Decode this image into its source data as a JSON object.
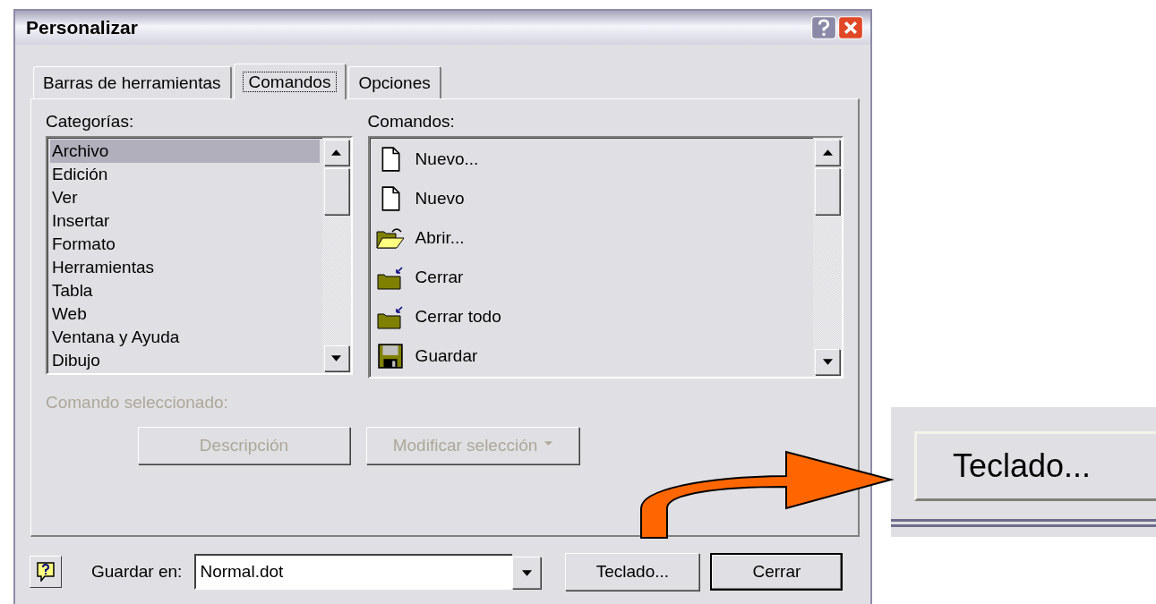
{
  "window": {
    "title": "Personalizar"
  },
  "tabs": [
    {
      "label": "Barras de herramientas",
      "selected": false
    },
    {
      "label": "Comandos",
      "selected": true
    },
    {
      "label": "Opciones",
      "selected": false
    }
  ],
  "categories": {
    "label": "Categorías:",
    "items": [
      {
        "label": "Archivo",
        "selected": true
      },
      {
        "label": "Edición",
        "selected": false
      },
      {
        "label": "Ver",
        "selected": false
      },
      {
        "label": "Insertar",
        "selected": false
      },
      {
        "label": "Formato",
        "selected": false
      },
      {
        "label": "Herramientas",
        "selected": false
      },
      {
        "label": "Tabla",
        "selected": false
      },
      {
        "label": "Web",
        "selected": false
      },
      {
        "label": "Ventana y Ayuda",
        "selected": false
      },
      {
        "label": "Dibujo",
        "selected": false
      }
    ]
  },
  "commands": {
    "label": "Comandos:",
    "items": [
      {
        "label": "Nuevo...",
        "kind": "new"
      },
      {
        "label": "Nuevo",
        "kind": "new"
      },
      {
        "label": "Abrir...",
        "kind": "open"
      },
      {
        "label": "Cerrar",
        "kind": "close"
      },
      {
        "label": "Cerrar todo",
        "kind": "close"
      },
      {
        "label": "Guardar",
        "kind": "save"
      }
    ]
  },
  "selected_command": {
    "label": "Comando seleccionado:",
    "disabled": true
  },
  "command_buttons": [
    {
      "label": "Descripción",
      "disabled": true,
      "dropdown": false
    },
    {
      "label": "Modificar selección",
      "disabled": true,
      "dropdown": true
    }
  ],
  "save_in": {
    "label": "Guardar en:",
    "value": "Normal.dot"
  },
  "footer_buttons": [
    {
      "label": "Teclado...",
      "default": false
    },
    {
      "label": "Cerrar",
      "default": true
    }
  ],
  "callout": {
    "label": "Teclado..."
  }
}
